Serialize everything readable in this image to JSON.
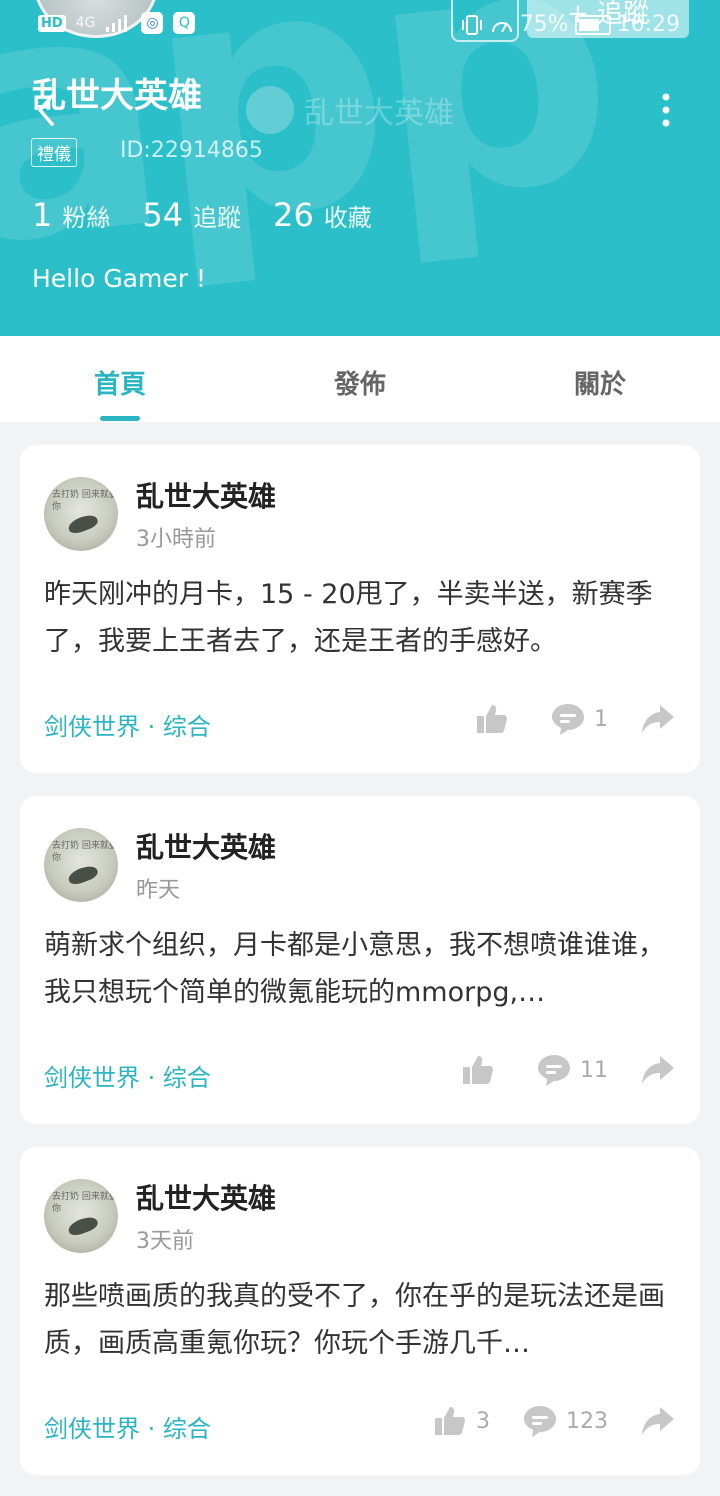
{
  "statusbar": {
    "hd": "HD",
    "net": "4G",
    "battery": "75%",
    "time": "16:29"
  },
  "profile": {
    "name": "乱世大英雄",
    "title_ghost": "乱世大英雄",
    "follow_label": "+ 追蹤",
    "tag": "禮儀",
    "id": "ID:22914865",
    "stats": [
      {
        "num": "1",
        "label": "粉絲"
      },
      {
        "num": "54",
        "label": "追蹤"
      },
      {
        "num": "26",
        "label": "收藏"
      }
    ],
    "bio": "Hello Gamer !"
  },
  "tabs": [
    {
      "label": "首頁",
      "active": true
    },
    {
      "label": "發佈",
      "active": false
    },
    {
      "label": "關於",
      "active": false
    }
  ],
  "posts": [
    {
      "author": "乱世大英雄",
      "time": "3小時前",
      "text": "昨天刚冲的月卡，15 - 20甩了，半卖半送，新赛季了，我要上王者去了，还是王者的手感好。",
      "category": "剑侠世界 · 综合",
      "likes": "",
      "comments": "1"
    },
    {
      "author": "乱世大英雄",
      "time": "昨天",
      "text": "萌新求个组织，月卡都是小意思，我不想喷谁谁谁，我只想玩个简单的微氪能玩的mmorpg,…",
      "category": "剑侠世界 · 综合",
      "likes": "",
      "comments": "11"
    },
    {
      "author": "乱世大英雄",
      "time": "3天前",
      "text": "那些喷画质的我真的受不了，你在乎的是玩法还是画质，画质高重氪你玩？你玩个手游几千…",
      "category": "剑侠世界 · 综合",
      "likes": "3",
      "comments": "123"
    }
  ],
  "avatar_text": "去打奶 回来就娶你",
  "colors": {
    "header": "#2bbfc9",
    "accent": "#2bb5c3",
    "background": "#f2f3f5"
  },
  "icons": [
    "back-icon",
    "more-icon",
    "like-icon",
    "comment-icon",
    "share-icon"
  ]
}
